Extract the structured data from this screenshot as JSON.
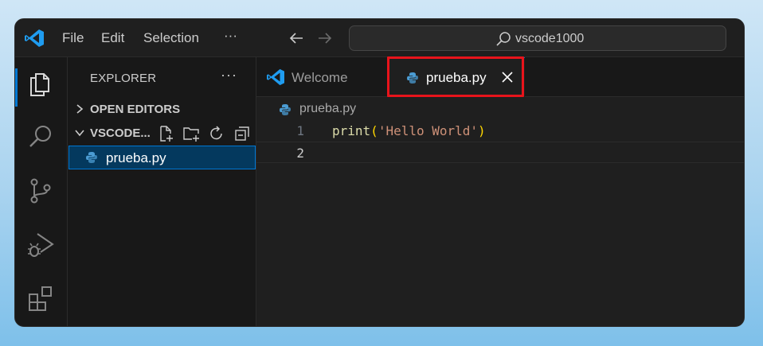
{
  "titlebar": {
    "menu": [
      {
        "label": "File"
      },
      {
        "label": "Edit"
      },
      {
        "label": "Selection"
      },
      {
        "label": "···"
      }
    ],
    "search_text": "vscode1000"
  },
  "activitybar": {
    "icons": [
      "files-icon",
      "search-icon",
      "source-control-icon",
      "run-debug-icon",
      "extensions-icon"
    ]
  },
  "sidebar": {
    "title": "EXPLORER",
    "more": "···",
    "open_editors": "OPEN EDITORS",
    "folder": "VSCODE...",
    "files": [
      {
        "name": "prueba.py",
        "selected": true
      }
    ]
  },
  "editor": {
    "tabs": [
      {
        "label": "Welcome",
        "active": false
      },
      {
        "label": "prueba.py",
        "active": true
      }
    ],
    "breadcrumb": "prueba.py",
    "lines": [
      {
        "num": "1",
        "tokens": [
          {
            "type": "fn",
            "text": "print"
          },
          {
            "type": "paren",
            "text": "("
          },
          {
            "type": "str",
            "text": "'Hello World'"
          },
          {
            "type": "paren",
            "text": ")"
          }
        ]
      },
      {
        "num": "2",
        "tokens": []
      }
    ]
  },
  "colors": {
    "accent": "#0078d4",
    "highlight_box": "#e8141b",
    "selection_bg": "#04395e"
  }
}
